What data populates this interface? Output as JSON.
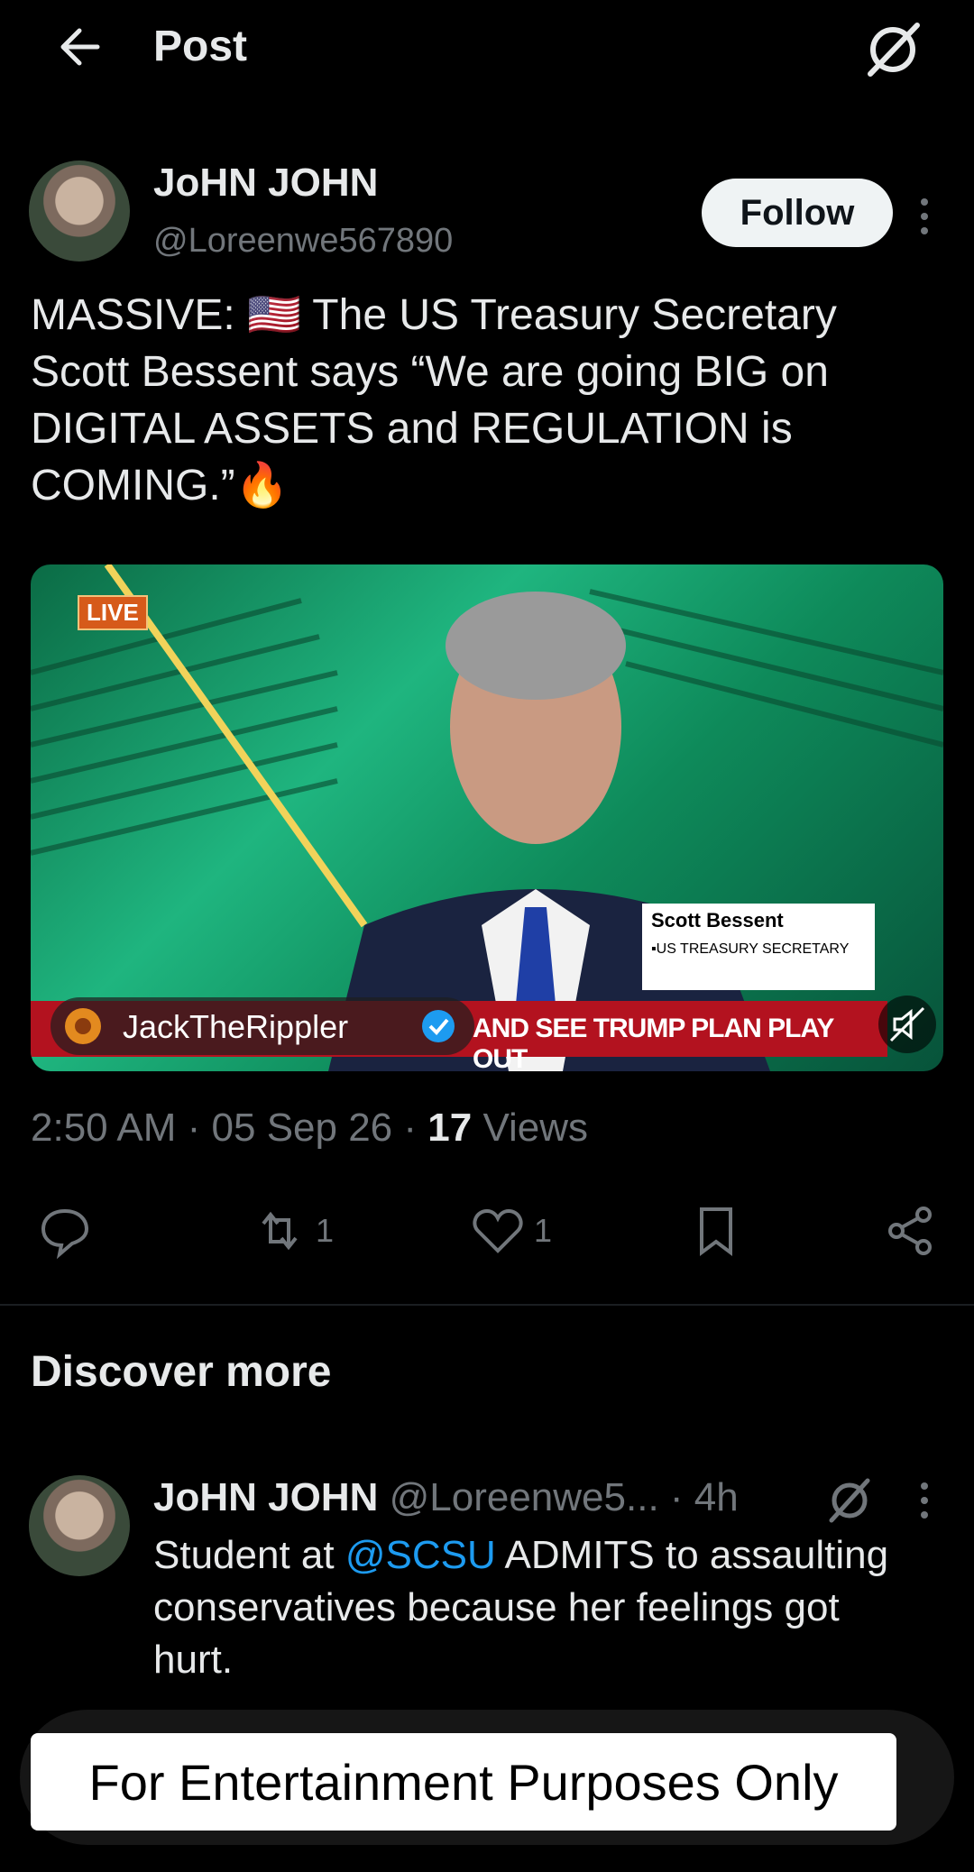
{
  "header": {
    "title": "Post"
  },
  "post": {
    "author_name": "JoHN JOHN",
    "author_handle": "@Loreenwe567890",
    "follow_label": "Follow",
    "text": "MASSIVE: 🇺🇸 The US Treasury Secretary Scott Bessent says “We are going BIG on DIGITAL ASSETS and REGULATION is COMING.”🔥",
    "media": {
      "live_badge": "LIVE",
      "lower_third_name": "Scott Bessent",
      "lower_third_role": "▪US TREASURY SECRETARY",
      "ticker_text": "AND SEE TRUMP PLAN PLAY OUT",
      "channel_name": "JackTheRippler"
    },
    "timestamp": "2:50 AM · 05 Sep 26 · ",
    "views_count": "17",
    "views_label": " Views",
    "actions": {
      "reposts": "1",
      "likes": "1"
    }
  },
  "discover": {
    "title": "Discover more",
    "item": {
      "name": "JoHN JOHN",
      "meta": " @Loreenwe5... · 4h",
      "text_pre": "Student at ",
      "mention": "@SCSU",
      "text_post": " ADMITS to assaulting conservatives because her feelings got hurt."
    }
  },
  "overlay": {
    "disclaimer": "For Entertainment Purposes Only"
  },
  "colors": {
    "accent": "#1d9bf0",
    "muted": "#71767b",
    "text": "#e7e9ea",
    "background": "#000000"
  }
}
